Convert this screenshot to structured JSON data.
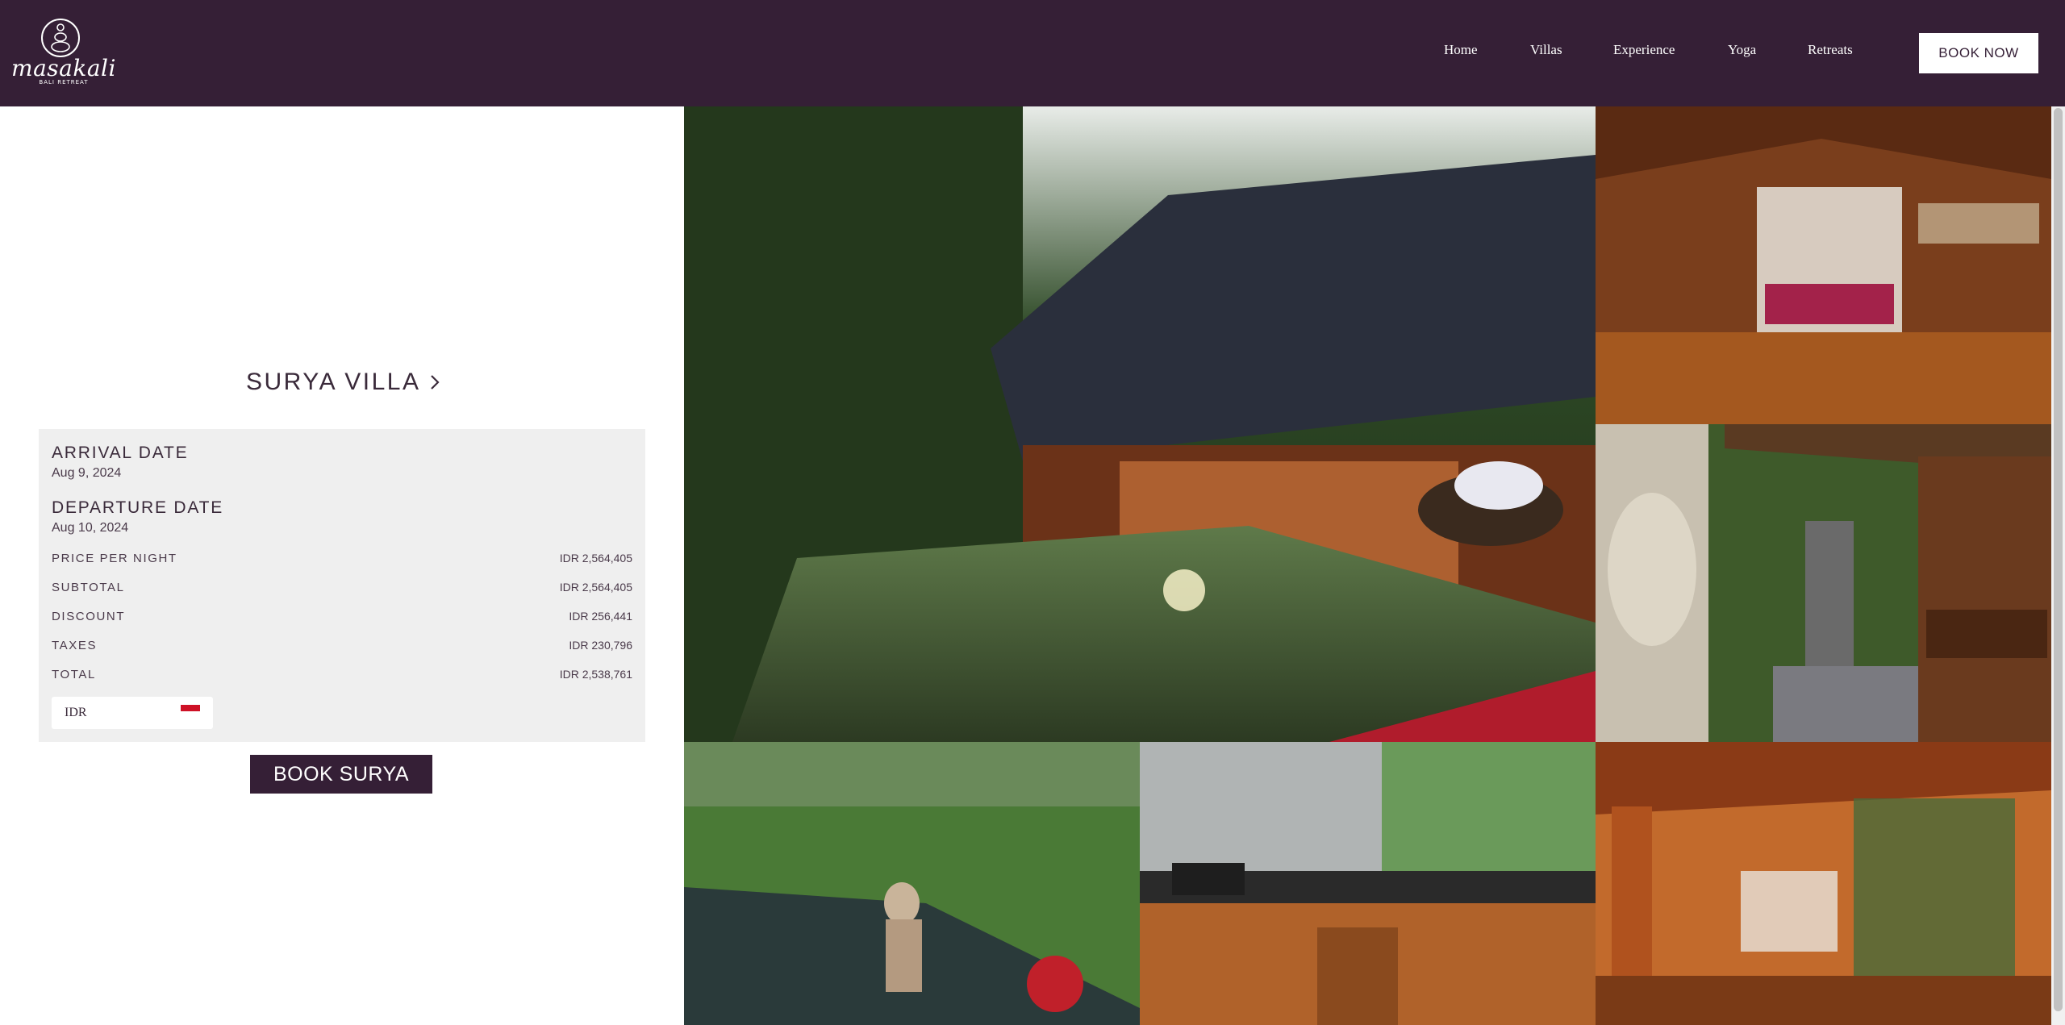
{
  "header": {
    "logo": {
      "word": "masakali",
      "sub": "BALI RETREAT"
    },
    "nav": [
      "Home",
      "Villas",
      "Experience",
      "Yoga",
      "Retreats"
    ],
    "book_now": "BOOK NOW"
  },
  "villa": {
    "title": "SURYA VILLA"
  },
  "booking": {
    "arrival_label": "ARRIVAL DATE",
    "arrival_value": "Aug 9, 2024",
    "departure_label": "DEPARTURE DATE",
    "departure_value": "Aug 10, 2024",
    "rows": [
      {
        "label": "PRICE PER NIGHT",
        "value": "IDR 2,564,405"
      },
      {
        "label": "SUBTOTAL",
        "value": "IDR 2,564,405"
      },
      {
        "label": "DISCOUNT",
        "value": "IDR 256,441"
      },
      {
        "label": "TAXES",
        "value": "IDR 230,796"
      },
      {
        "label": "TOTAL",
        "value": "IDR 2,538,761"
      }
    ],
    "currency": "IDR",
    "book_button": "BOOK SURYA"
  },
  "colors": {
    "brand": "#351f36",
    "panel": "#efefef",
    "flag_red": "#ce1126"
  },
  "icons": [
    "masakali-logo-icon",
    "chevron-right-icon",
    "indonesia-flag-icon"
  ]
}
